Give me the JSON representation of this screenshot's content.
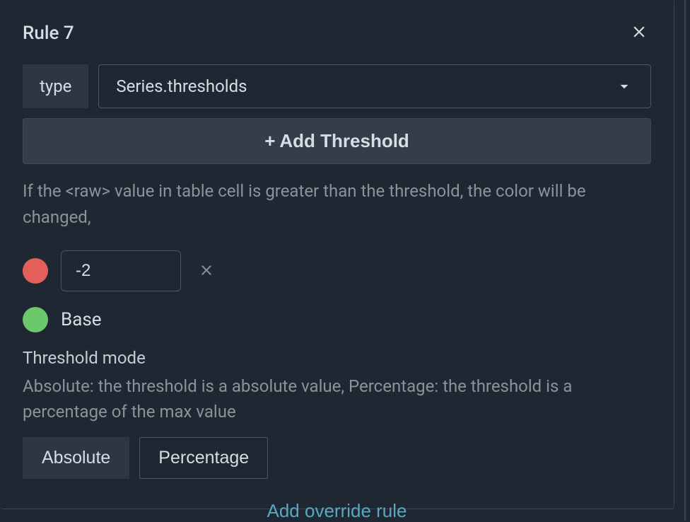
{
  "rule": {
    "title": "Rule 7",
    "type_label": "type",
    "type_value": "Series.thresholds"
  },
  "buttons": {
    "add_threshold": "Add Threshold"
  },
  "help": {
    "threshold_desc": "If the <raw> value in table cell is greater than the threshold, the color will be changed,"
  },
  "thresholds": [
    {
      "color": "red",
      "value": "-2"
    }
  ],
  "base": {
    "label": "Base",
    "color": "green"
  },
  "threshold_mode": {
    "label": "Threshold mode",
    "help": "Absolute: the threshold is a absolute value, Percentage: the threshold is a percentage of the max value",
    "options": {
      "absolute": "Absolute",
      "percentage": "Percentage"
    },
    "selected": "absolute"
  },
  "footer": {
    "add_override": "Add override rule"
  }
}
